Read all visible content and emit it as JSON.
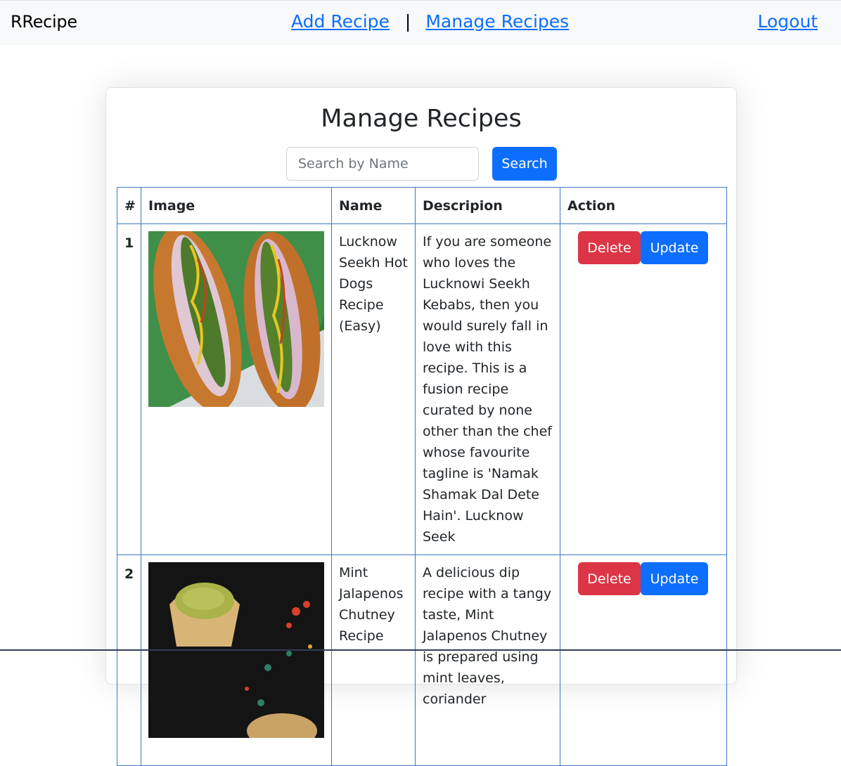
{
  "nav": {
    "brand": "RRecipe",
    "add_recipe": "Add Recipe",
    "separator": "|",
    "manage_recipes": "Manage Recipes",
    "logout": "Logout"
  },
  "page": {
    "title": "Manage Recipes",
    "search_placeholder": "Search by Name",
    "search_button": "Search"
  },
  "table": {
    "headers": [
      "#",
      "Image",
      "Name",
      "Descripion",
      "Action"
    ],
    "rows": [
      {
        "num": "1",
        "name": "Lucknow Seekh Hot Dogs Recipe (Easy)",
        "description": "If you are someone who loves the Lucknowi Seekh Kebabs, then you would surely fall in love with this recipe. This is a fusion recipe curated by none other than the chef whose favourite tagline is 'Namak Shamak Dal Dete Hain'. Lucknow Seek",
        "delete": "Delete",
        "update": "Update"
      },
      {
        "num": "2",
        "name": "Mint Jalapenos Chutney Recipe",
        "description": "A delicious dip recipe with a tangy taste, Mint Jalapenos Chutney is prepared using mint leaves, coriander",
        "delete": "Delete",
        "update": "Update"
      }
    ]
  },
  "colors": {
    "primary": "#0d6efd",
    "danger": "#dc3545",
    "table_border": "#3b78c4",
    "navbar_bg": "#f8f9fa"
  }
}
